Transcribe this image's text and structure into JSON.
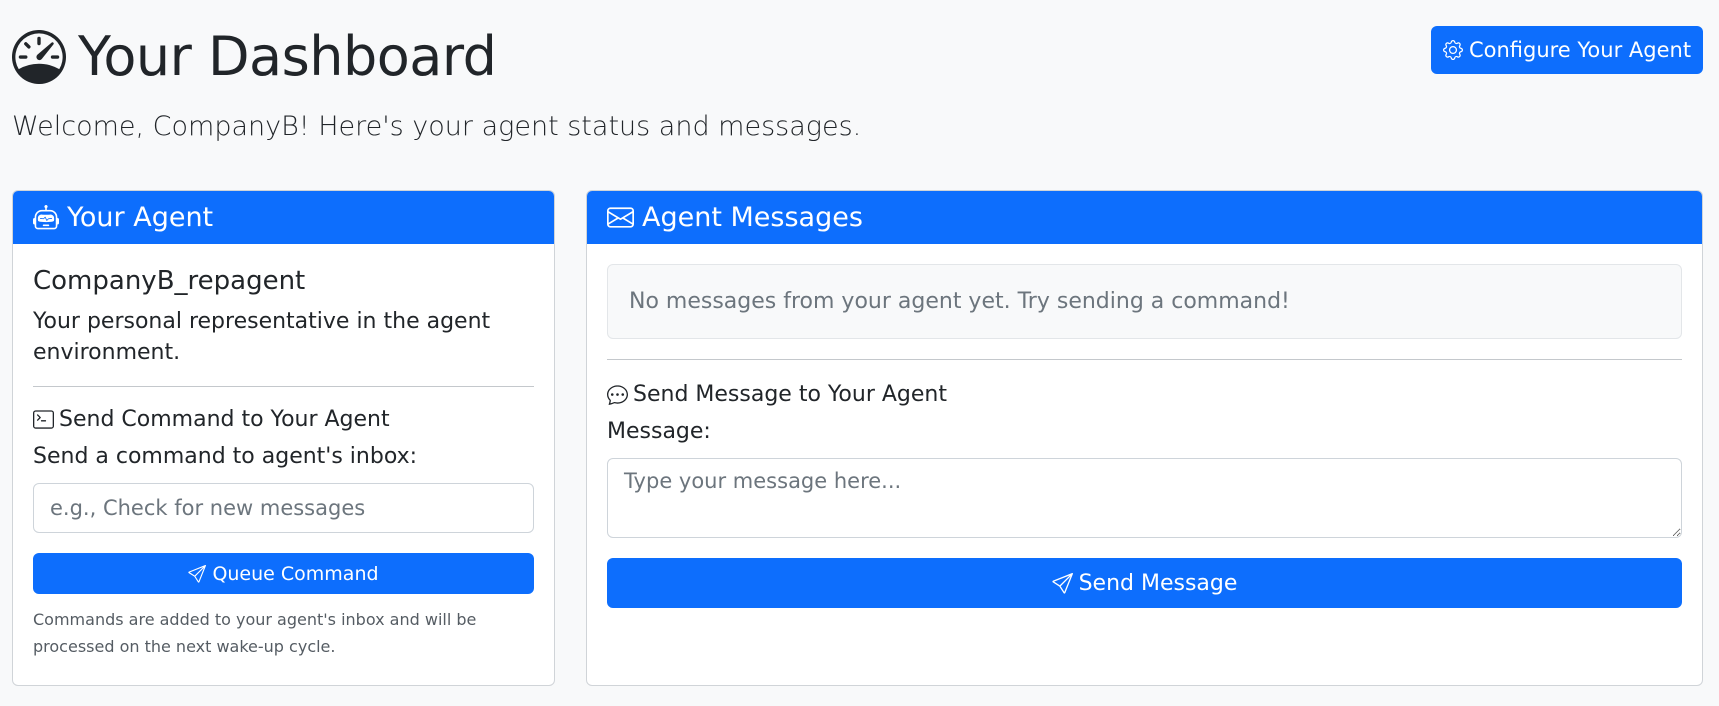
{
  "header": {
    "title": "Your Dashboard",
    "title_icon": "speedometer-icon",
    "subtitle": "Welcome, CompanyB! Here's your agent status and messages."
  },
  "configure_button": {
    "label": "Configure Your Agent",
    "icon": "gear-icon"
  },
  "agent_card": {
    "header": "Your Agent",
    "header_icon": "robot-icon",
    "agent_name": "CompanyB_repagent",
    "description": "Your personal representative in the agent environment.",
    "command_section": {
      "title": "Send Command to Your Agent",
      "title_icon": "terminal-icon",
      "label": "Send a command to agent's inbox:",
      "input_value": "",
      "input_placeholder": "e.g., Check for new messages",
      "button_label": "Queue Command",
      "button_icon": "send-icon",
      "help_text": "Commands are added to your agent's inbox and will be processed on the next wake-up cycle."
    }
  },
  "messages_card": {
    "header": "Agent Messages",
    "header_icon": "envelope-icon",
    "empty_text": "No messages from your agent yet. Try sending a command!",
    "send_section": {
      "title": "Send Message to Your Agent",
      "title_icon": "chat-dots-icon",
      "label": "Message:",
      "textarea_value": "",
      "textarea_placeholder": "Type your message here...",
      "button_label": "Send Message",
      "button_icon": "send-icon"
    }
  },
  "colors": {
    "primary": "#0d6efd",
    "background": "#f8f9fa",
    "text": "#212529",
    "muted": "#6c757d"
  }
}
